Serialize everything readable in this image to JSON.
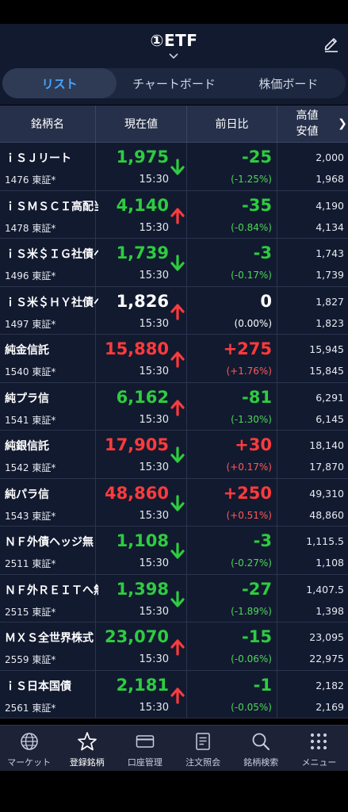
{
  "header": {
    "title": "①ETF"
  },
  "tabs": [
    {
      "label": "リスト",
      "active": true
    },
    {
      "label": "チャートボード",
      "active": false
    },
    {
      "label": "株価ボード",
      "active": false
    }
  ],
  "columns": {
    "name": "銘柄名",
    "price": "現在値",
    "change": "前日比",
    "high": "高値",
    "low": "安値",
    "more": "❯"
  },
  "rows": [
    {
      "name": "ｉＳＪリート",
      "code": "1476 東証*",
      "price": "1,975",
      "time": "15:30",
      "dir": "down",
      "change": "-25",
      "pct": "(-1.25%)",
      "high": "2,000",
      "low": "1,968"
    },
    {
      "name": "ｉＳＭＳＣＩ高配当",
      "code": "1478 東証*",
      "price": "4,140",
      "time": "15:30",
      "dir": "up",
      "change": "-35",
      "pct": "(-0.84%)",
      "high": "4,190",
      "low": "4,134",
      "price_color": "down",
      "change_color": "down"
    },
    {
      "name": "ｉＳ米＄ＩＧ社債ヘジ",
      "code": "1496 東証*",
      "price": "1,739",
      "time": "15:30",
      "dir": "down",
      "change": "-3",
      "pct": "(-0.17%)",
      "high": "1,743",
      "low": "1,739"
    },
    {
      "name": "ｉＳ米＄ＨＹ社債ヘジ",
      "code": "1497 東証*",
      "price": "1,826",
      "time": "15:30",
      "dir": "up",
      "change": "0",
      "pct": "(0.00%)",
      "high": "1,827",
      "low": "1,823",
      "price_color": "flat",
      "change_color": "flat"
    },
    {
      "name": "純金信託",
      "code": "1540 東証*",
      "price": "15,880",
      "time": "15:30",
      "dir": "up",
      "change": "+275",
      "pct": "(+1.76%)",
      "high": "15,945",
      "low": "15,845",
      "price_color": "up",
      "change_color": "up"
    },
    {
      "name": "純プラ信",
      "code": "1541 東証*",
      "price": "6,162",
      "time": "15:30",
      "dir": "up",
      "change": "-81",
      "pct": "(-1.30%)",
      "high": "6,291",
      "low": "6,145",
      "price_color": "down",
      "change_color": "down"
    },
    {
      "name": "純銀信託",
      "code": "1542 東証*",
      "price": "17,905",
      "time": "15:30",
      "dir": "down",
      "change": "+30",
      "pct": "(+0.17%)",
      "high": "18,140",
      "low": "17,870",
      "price_color": "up",
      "change_color": "up"
    },
    {
      "name": "純パラ信",
      "code": "1543 東証*",
      "price": "48,860",
      "time": "15:30",
      "dir": "down",
      "change": "+250",
      "pct": "(+0.51%)",
      "high": "49,310",
      "low": "48,860",
      "price_color": "up",
      "change_color": "up"
    },
    {
      "name": "ＮＦ外債ヘッジ無",
      "code": "2511 東証*",
      "price": "1,108",
      "time": "15:30",
      "dir": "down",
      "change": "-3",
      "pct": "(-0.27%)",
      "high": "1,115.5",
      "low": "1,108"
    },
    {
      "name": "ＮＦ外ＲＥＩＴへ無",
      "code": "2515 東証*",
      "price": "1,398",
      "time": "15:30",
      "dir": "down",
      "change": "-27",
      "pct": "(-1.89%)",
      "high": "1,407.5",
      "low": "1,398"
    },
    {
      "name": "ＭＸＳ全世界株式",
      "code": "2559 東証*",
      "price": "23,070",
      "time": "15:30",
      "dir": "up",
      "change": "-15",
      "pct": "(-0.06%)",
      "high": "23,095",
      "low": "22,975",
      "price_color": "down",
      "change_color": "down"
    },
    {
      "name": "ｉＳ日本国債",
      "code": "2561 東証*",
      "price": "2,181",
      "time": "15:30",
      "dir": "up",
      "change": "-1",
      "pct": "(-0.05%)",
      "high": "2,182",
      "low": "2,169",
      "price_color": "down",
      "change_color": "down"
    }
  ],
  "nav": [
    {
      "label": "マーケット",
      "icon": "globe-icon",
      "active": false
    },
    {
      "label": "登録銘柄",
      "icon": "star-icon",
      "active": true
    },
    {
      "label": "口座管理",
      "icon": "card-icon",
      "active": false
    },
    {
      "label": "注文照会",
      "icon": "document-icon",
      "active": false
    },
    {
      "label": "銘柄検索",
      "icon": "search-icon",
      "active": false
    },
    {
      "label": "メニュー",
      "icon": "grid-icon",
      "active": false
    }
  ],
  "colors": {
    "up": "#ff3b3b",
    "down": "#2ecc40",
    "accent": "#46a6ff",
    "background": "#121a30"
  }
}
